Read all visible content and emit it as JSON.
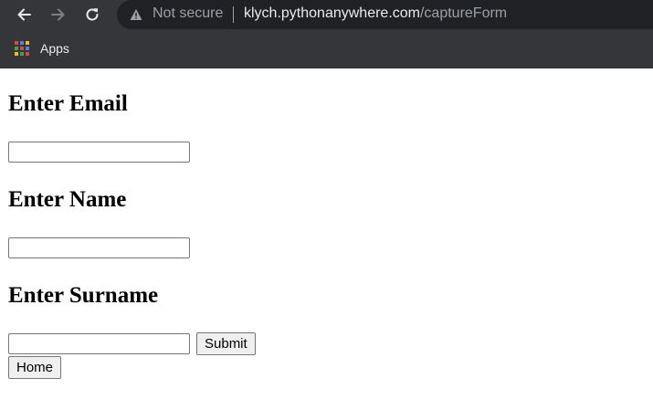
{
  "browser": {
    "security_label": "Not secure",
    "url_host": "klych.pythonanywhere.com",
    "url_path": "/captureForm",
    "bookmarks": [
      {
        "label": "Apps",
        "icon": "apps-grid-icon"
      }
    ],
    "colors": {
      "toolbar": "#35363a",
      "omnibox": "#202124",
      "text": "#e8eaed",
      "muted": "#9aa0a6"
    }
  },
  "form": {
    "email_heading": "Enter Email",
    "email_value": "",
    "name_heading": "Enter Name",
    "name_value": "",
    "surname_heading": "Enter Surname",
    "surname_value": "",
    "submit_label": "Submit",
    "home_label": "Home"
  }
}
